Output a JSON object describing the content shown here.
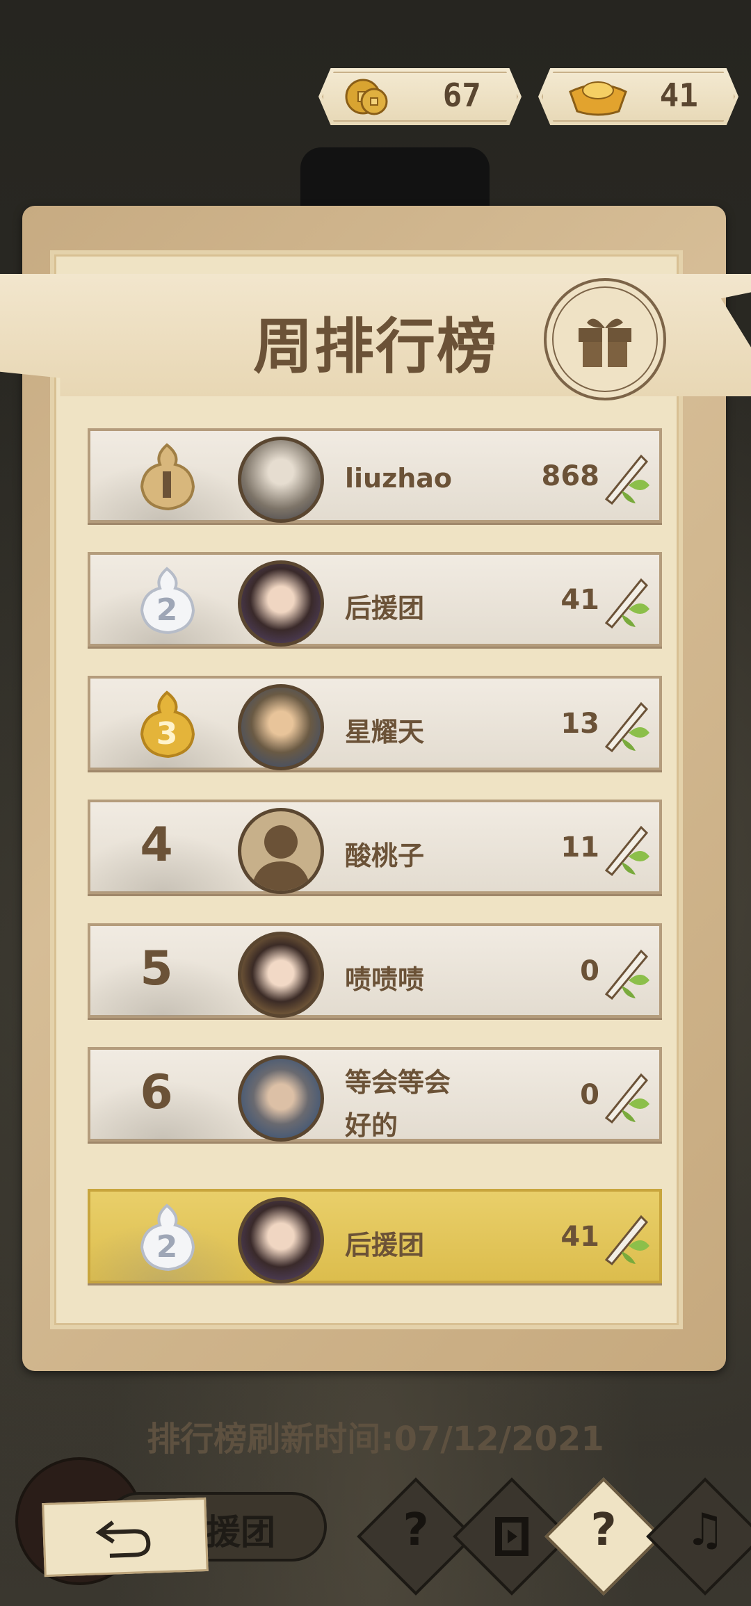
{
  "currency": {
    "coins": "67",
    "ingots": "41"
  },
  "title": "周排行榜",
  "rows": [
    {
      "rank": "1",
      "name": "liuzhao",
      "score": "868",
      "medal": "gold-medal-icon"
    },
    {
      "rank": "2",
      "name": "后援团",
      "score": "41",
      "medal": "silver-medal-icon"
    },
    {
      "rank": "3",
      "name": "星耀天",
      "score": "13",
      "medal": "bronze-medal-icon"
    },
    {
      "rank": "4",
      "name": "酸桃子",
      "score": "11"
    },
    {
      "rank": "5",
      "name": "啧啧啧",
      "score": "0"
    },
    {
      "rank": "6",
      "name_line1": "等会等会",
      "name_line2": "好的",
      "score": "0"
    }
  ],
  "me": {
    "rank": "2",
    "name": "后援团",
    "score": "41"
  },
  "refresh_text": "排行榜刷新时间:07/12/2021",
  "bottom": {
    "player_name": "援团",
    "help_glyph": "?",
    "music_glyph": "♫"
  },
  "colors": {
    "accent": "#6b5237",
    "highlight": "#dcbd4d"
  }
}
